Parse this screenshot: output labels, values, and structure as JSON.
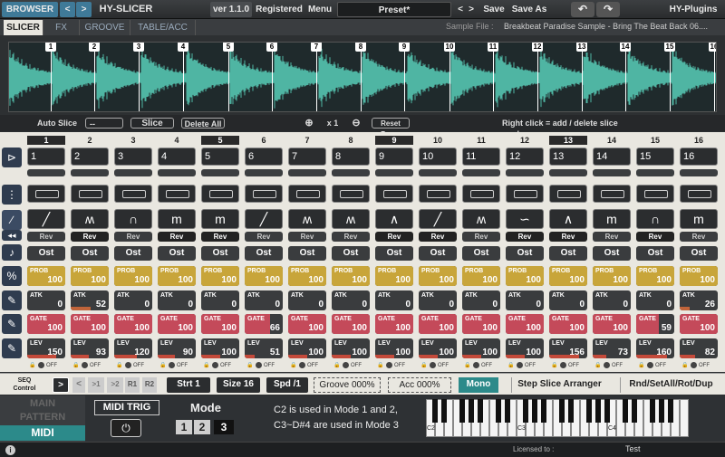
{
  "topbar": {
    "browser": "BROWSER",
    "nav_prev": "<",
    "nav_next": ">",
    "product": "HY-SLICER",
    "version": "ver 1.1.0",
    "registered": "Registered",
    "menu": "Menu",
    "preset": "Preset*",
    "preset_prev": "<",
    "preset_next": ">",
    "save": "Save",
    "save_as": "Save As",
    "vendor": "HY-Plugins"
  },
  "tabs": [
    "SLICER",
    "FX",
    "GROOVE",
    "TABLE/ACC"
  ],
  "sample": {
    "label": "Sample File :",
    "name": "Breakbeat Paradise Sample - Bring The Beat Back 06...."
  },
  "markers": [
    "1",
    "2",
    "3",
    "4",
    "5",
    "6",
    "7",
    "8",
    "9",
    "10",
    "11",
    "12",
    "13",
    "14",
    "15",
    "16"
  ],
  "slicebar": {
    "auto_slice": "Auto Slice",
    "auto_value": "--",
    "slice": "Slice",
    "delete_all": "Delete All",
    "zoom": "x 1",
    "reset_zoom": "Reset Zoom",
    "hint": "Right click = add / delete slice marker"
  },
  "steps": {
    "numbers": [
      "1",
      "2",
      "3",
      "4",
      "5",
      "6",
      "7",
      "8",
      "9",
      "10",
      "11",
      "12",
      "13",
      "14",
      "15",
      "16"
    ],
    "highlighted": [
      1,
      5,
      9,
      13
    ],
    "select_values": [
      "1",
      "2",
      "3",
      "4",
      "5",
      "6",
      "7",
      "8",
      "9",
      "10",
      "11",
      "12",
      "13",
      "14",
      "15",
      "16"
    ],
    "rev_label": "Rev",
    "rev_on": [
      2,
      4,
      5,
      9,
      10,
      12,
      13,
      15
    ],
    "ost_label": "Ost",
    "prob_label": "PROB",
    "prob": [
      "100",
      "100",
      "100",
      "100",
      "100",
      "100",
      "100",
      "100",
      "100",
      "100",
      "100",
      "100",
      "100",
      "100",
      "100",
      "100"
    ],
    "atk_label": "ATK",
    "atk": [
      "0",
      "52",
      "0",
      "0",
      "0",
      "0",
      "0",
      "0",
      "0",
      "0",
      "0",
      "0",
      "0",
      "0",
      "0",
      "26"
    ],
    "gate_label": "GATE",
    "gate": [
      "100",
      "100",
      "100",
      "100",
      "100",
      "66",
      "100",
      "100",
      "100",
      "100",
      "100",
      "100",
      "100",
      "100",
      "59",
      "100"
    ],
    "lev_label": "LEV",
    "lev": [
      "150",
      "93",
      "120",
      "90",
      "100",
      "51",
      "100",
      "100",
      "100",
      "100",
      "100",
      "100",
      "156",
      "73",
      "160",
      "82"
    ],
    "off_label": "OFF",
    "shapes": [
      "╱",
      "ʍ",
      "∩",
      "m",
      "m",
      "╱",
      "ʍ",
      "ʍ",
      "∧",
      "╱",
      "ʍ",
      "∽",
      "∧",
      "m",
      "∩",
      "m"
    ]
  },
  "seq": {
    "label1": "SEQ",
    "label2": "Control",
    "play": ">",
    "back": "<",
    "x1": ">1",
    "x2": ">2",
    "r1": "R1",
    "r2": "R2",
    "strt": "Strt 1",
    "size": "Size 16",
    "spd": "Spd /1",
    "groove": "Groove 000%",
    "acc": "Acc 000%",
    "mono": "Mono",
    "arranger": "Step Slice Arranger",
    "rnd": "Rnd/SetAll/Rot/Dup"
  },
  "bottom": {
    "main": "MAIN",
    "pattern": "PATTERN",
    "midi": "MIDI",
    "midi_trig": "MIDI TRIG",
    "mode_label": "Mode",
    "modes": [
      "1",
      "2",
      "3"
    ],
    "info1": "C2 is used in Mode 1 and 2,",
    "info2": "C3~D#4 are used in Mode 3",
    "c2": "C2",
    "c3": "C3",
    "c4": "C4"
  },
  "status": {
    "licensed": "Licensed to :",
    "user": "Test",
    "info_icon": "i"
  },
  "colors": {
    "accent": "#3f7a98",
    "wave": "#4fb5a3",
    "prob": "#c8a53a",
    "gate": "#c44a5a",
    "mono": "#2c8a8a"
  }
}
